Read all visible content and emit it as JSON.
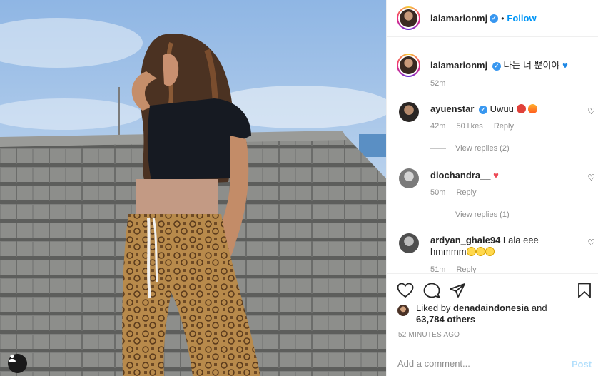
{
  "post": {
    "username": "lalamarionmj",
    "follow_label": "Follow",
    "dot": "•",
    "caption_text": "나는 너 뿐이야",
    "caption_time": "52m"
  },
  "comments": [
    {
      "username": "ayuenstar",
      "verified": true,
      "text": "Uwuu",
      "time": "42m",
      "likes": "50 likes",
      "reply": "Reply",
      "view_replies": "View replies (2)"
    },
    {
      "username": "diochandra__",
      "verified": false,
      "text": "",
      "time": "50m",
      "reply": "Reply",
      "view_replies": "View replies (1)"
    },
    {
      "username": "ardyan_ghale94",
      "verified": false,
      "text": "Lala eee hmmmm",
      "time": "51m",
      "reply": "Reply"
    }
  ],
  "likes": {
    "prefix": "Liked by",
    "user": "denadaindonesia",
    "and": "and",
    "count": "63,784 others"
  },
  "timestamp": "52 MINUTES AGO",
  "composer": {
    "placeholder": "Add a comment...",
    "post_label": "Post"
  },
  "icons": [
    "heart-icon",
    "comment-icon",
    "share-icon",
    "bookmark-icon",
    "user-tag-icon",
    "verified-icon"
  ],
  "colors": {
    "accent": "#0095f6",
    "post_disabled": "#b2dffc",
    "muted": "#8e8e8e",
    "verified": "#3897f0"
  }
}
